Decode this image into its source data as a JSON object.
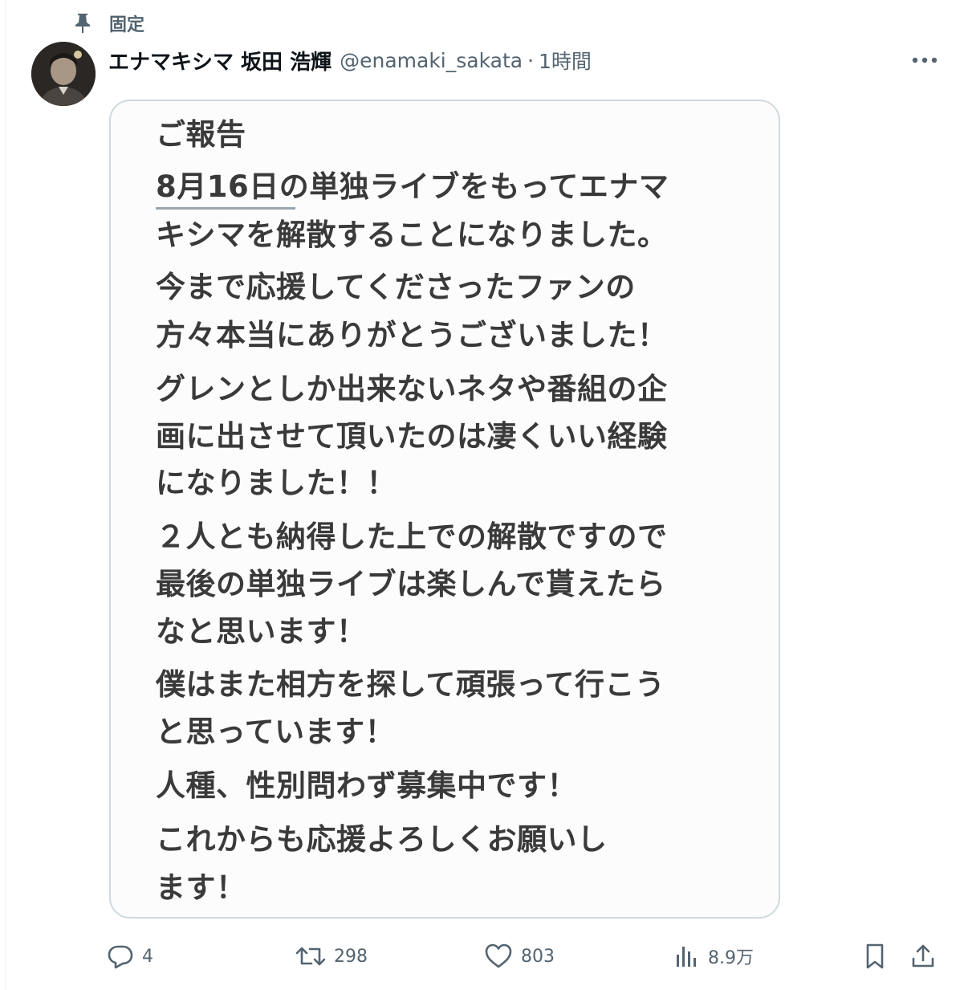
{
  "pinned": {
    "label": "固定"
  },
  "author": {
    "display_name": "エナマキシマ 坂田 浩輝",
    "handle": "@enamaki_sakata",
    "separator": "·",
    "time": "1時間"
  },
  "image_text": [
    "ご報告",
    "8月16日の単独ライブをもってエナマ",
    "キシマを解散することになりました。",
    "今まで応援してくださったファンの",
    "方々本当にありがとうございました！",
    "グレンとしか出来ないネタや番組の企",
    "画に出させて頂いたのは凄くいい経験",
    "になりました！！",
    "２人とも納得した上での解散ですので",
    "最後の単独ライブは楽しんで貰えたら",
    "なと思います！",
    "僕はまた相方を探して頑張って行こう",
    "と思っています！",
    "人種、性別問わず募集中です！",
    "これからも応援よろしくお願いし",
    "ます！"
  ],
  "actions": {
    "reply_count": "4",
    "repost_count": "298",
    "like_count": "803",
    "views_count": "8.9万"
  },
  "colors": {
    "muted": "#536471",
    "text": "#0f1419",
    "border": "#cfd9de"
  }
}
